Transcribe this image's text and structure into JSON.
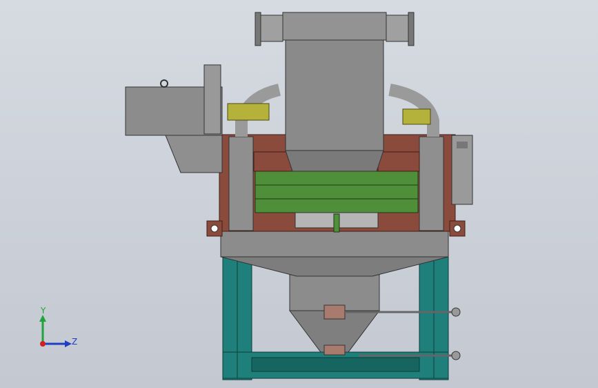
{
  "colors": {
    "background_top": "#d6dbe2",
    "background_bottom": "#c3c8d1",
    "steel_gray": "#8c8c8c",
    "dark_gray": "#5f5f5f",
    "frame_red": "#8a4b3c",
    "screen_green": "#4f8f3a",
    "base_teal": "#1f7f7a",
    "pipe_yellow": "#b4b23a",
    "axis_x": "#d02020",
    "axis_y": "#1fa33a",
    "axis_z": "#1f3fc0"
  },
  "triad": {
    "y_label": "Y",
    "z_label": "Z"
  }
}
